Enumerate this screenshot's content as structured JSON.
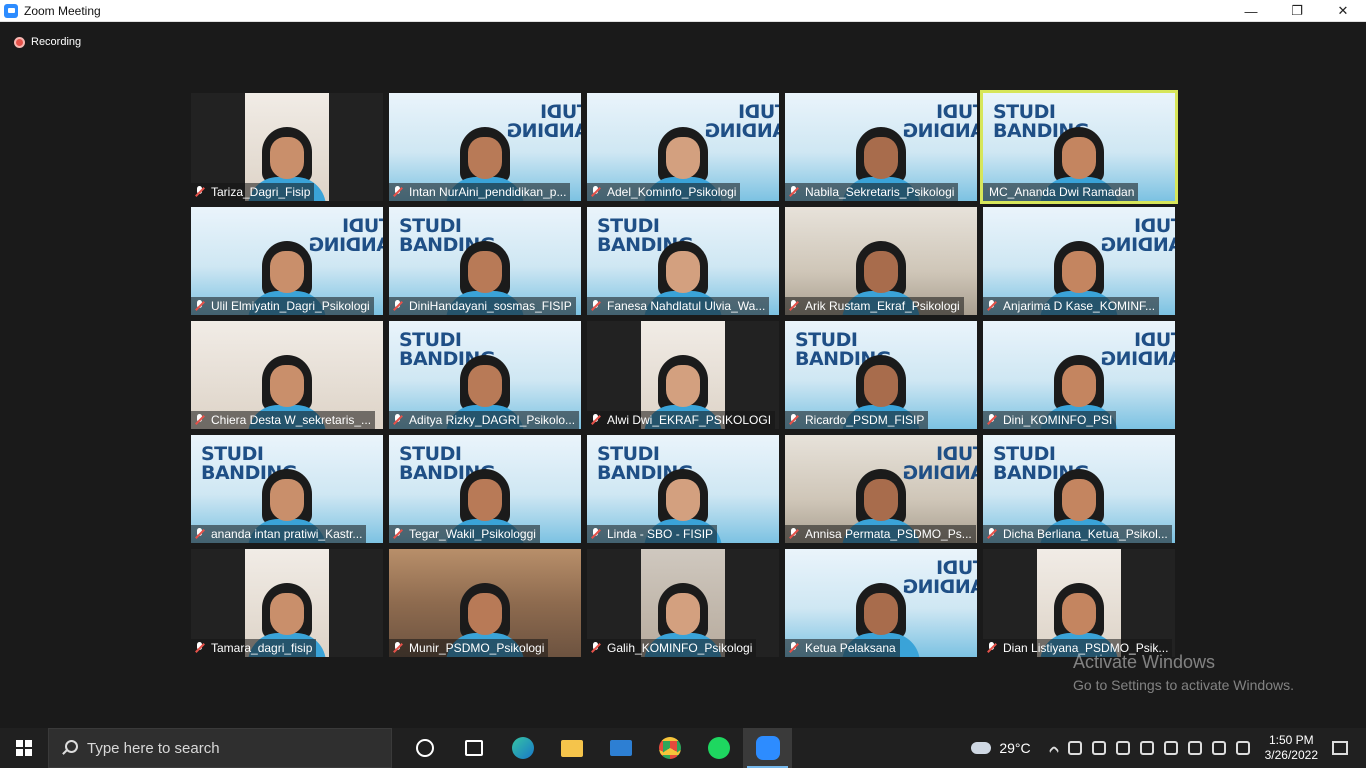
{
  "window": {
    "title": "Zoom Meeting",
    "minimize": "—",
    "restore": "❐",
    "close": "✕"
  },
  "recording": {
    "label": "Recording"
  },
  "participants": [
    "Tariza_Dagri_Fisip",
    "Intan NurAini_pendidikan_p...",
    "Adel_Kominfo_Psikologi",
    "Nabila_Sekretaris_Psikologi",
    "MC_Ananda Dwi Ramadan",
    "Ulil Elmiyatin_Dagri_Psikologi",
    "DiniHandayani_sosmas_FISIP",
    "Fanesa Nahdlatul Ulvia_Wa...",
    "Arik Rustam_Ekraf_Psikologi",
    "Anjarima D Kase_KOMINF...",
    "Chiera Desta W_sekretaris_...",
    "Aditya Rizky_DAGRI_Psikolo...",
    "Alwi Dwi_EKRAF_PSIKOLOGI",
    "Ricardo_PSDM_FISIP",
    "Dini_KOMINFO_PSI",
    "ananda intan pratiwi_Kastr...",
    "Tegar_Wakil_Psikologgi",
    "Linda - SBO - FISIP",
    "Annisa Permata_PSDMO_Ps...",
    "Dicha Berliana_Ketua_Psikol...",
    "Tamara_dagri_fisip",
    "Munir_PSDMO_Psikologi",
    "Galih_KOMINFO_Psikologi",
    "Ketua Pelaksana",
    "Dian Listiyana_PSDMO_Psik..."
  ],
  "banner_text": {
    "line1": "STUDI",
    "line2": "BANDING"
  },
  "active_speaker": "MC_Ananda Dwi Ramadan",
  "watermark": {
    "line1": "Activate Windows",
    "line2": "Go to Settings to activate Windows."
  },
  "taskbar": {
    "search_placeholder": "Type here to search",
    "temperature": "29°C",
    "time": "1:50 PM",
    "date": "3/26/2022"
  },
  "colors": {
    "accent": "#2d8cff",
    "speaker_border": "#d7e65a",
    "mic_muted": "#e5524a"
  }
}
